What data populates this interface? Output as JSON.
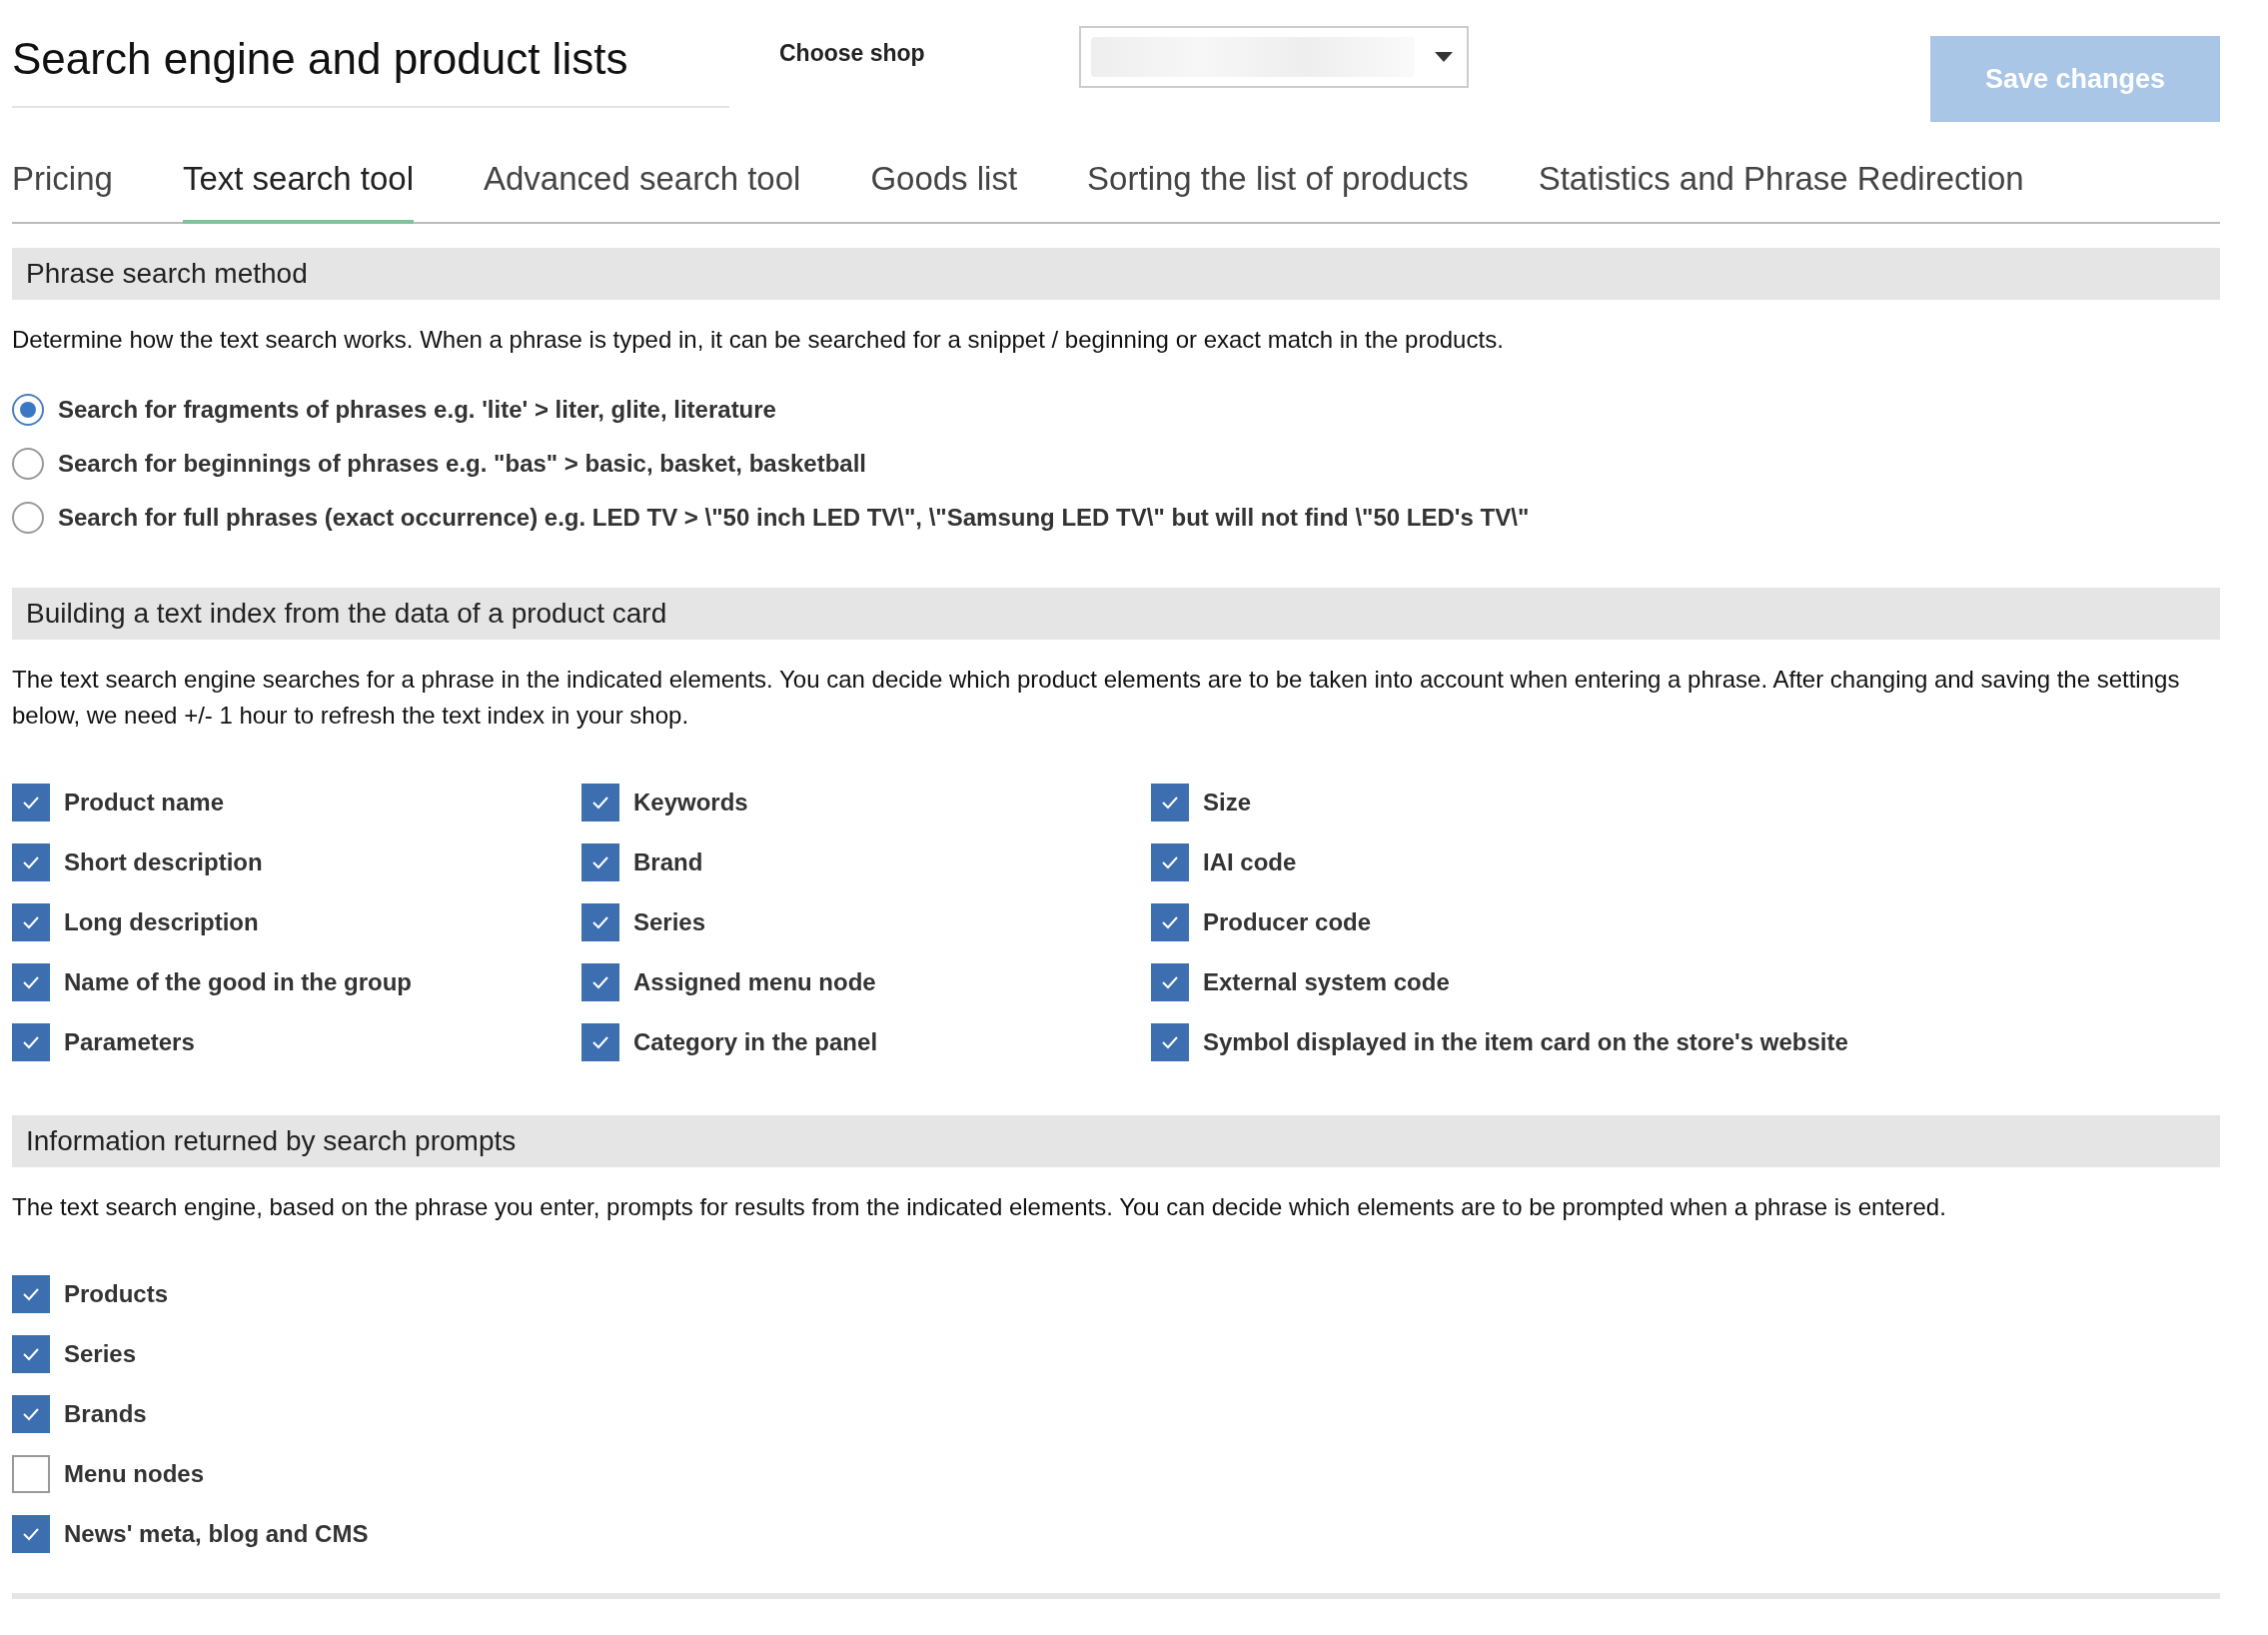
{
  "header": {
    "title": "Search engine and product lists",
    "shop_label": "Choose shop",
    "save_button": {
      "label": "Save changes",
      "disabled": true
    }
  },
  "tabs": [
    {
      "label": "Pricing",
      "selected": false
    },
    {
      "label": "Text search tool",
      "selected": true
    },
    {
      "label": "Advanced search tool",
      "selected": false
    },
    {
      "label": "Goods list",
      "selected": false
    },
    {
      "label": "Sorting the list of products",
      "selected": false
    },
    {
      "label": "Statistics and Phrase Redirection",
      "selected": false
    }
  ],
  "sections": [
    {
      "kind": "radios",
      "title": "Phrase search method",
      "description": "Determine how the text search works. When a phrase is typed in, it can be searched for a snippet / beginning or exact match in the products.",
      "options": [
        {
          "label": "Search for fragments of phrases e.g. 'lite' > liter, glite, literature",
          "selected": true
        },
        {
          "label": "Search for beginnings of phrases e.g. \"bas\" > basic, basket, basketball",
          "selected": false
        },
        {
          "label": "Search for full phrases (exact occurrence) e.g. LED TV > \\\"50 inch LED TV\\\", \\\"Samsung LED TV\\\" but will not find \\\"50 LED's TV\\\"",
          "selected": false
        }
      ]
    },
    {
      "kind": "checkgrid",
      "title": "Building a text index from the data of a product card",
      "description": "The text search engine searches for a phrase in the indicated elements. You can decide which product elements are to be taken into account when entering a phrase. After changing and saving the settings below, we need +/- 1 hour to refresh the text index in your shop.",
      "options": [
        {
          "label": "Product name",
          "checked": true
        },
        {
          "label": "Keywords",
          "checked": true
        },
        {
          "label": "Size",
          "checked": true
        },
        {
          "label": "Short description",
          "checked": true
        },
        {
          "label": "Brand",
          "checked": true
        },
        {
          "label": "IAI code",
          "checked": true
        },
        {
          "label": "Long description",
          "checked": true
        },
        {
          "label": "Series",
          "checked": true
        },
        {
          "label": "Producer code",
          "checked": true
        },
        {
          "label": "Name of the good in the group",
          "checked": true
        },
        {
          "label": "Assigned menu node",
          "checked": true
        },
        {
          "label": "External system code",
          "checked": true
        },
        {
          "label": "Parameters",
          "checked": true
        },
        {
          "label": "Category in the panel",
          "checked": true
        },
        {
          "label": "Symbol displayed in the item card on the store's website",
          "checked": true
        }
      ]
    },
    {
      "kind": "checks",
      "title": "Information returned by search prompts",
      "description": "The text search engine, based on the phrase you enter, prompts for results from the indicated elements. You can decide which elements are to be prompted when a phrase is entered.",
      "options": [
        {
          "label": "Products",
          "checked": true
        },
        {
          "label": "Series",
          "checked": true
        },
        {
          "label": "Brands",
          "checked": true
        },
        {
          "label": "Menu nodes",
          "checked": false
        },
        {
          "label": "News' meta, blog and CMS",
          "checked": true
        }
      ]
    }
  ]
}
